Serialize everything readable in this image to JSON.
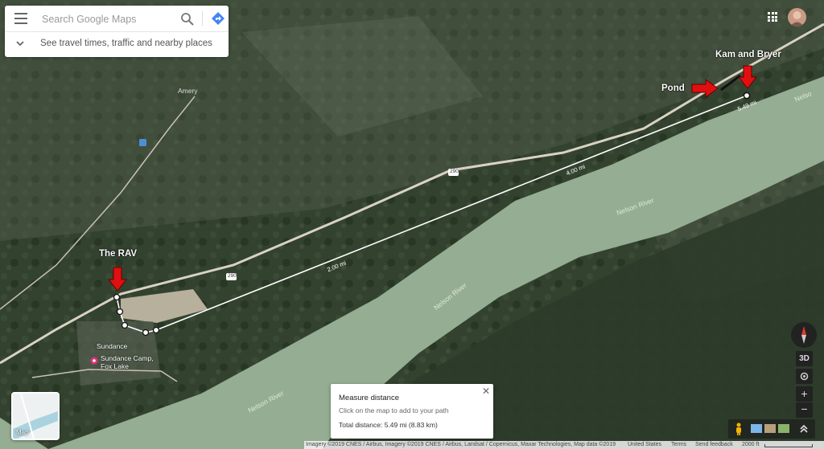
{
  "search": {
    "placeholder": "Search Google Maps"
  },
  "travel_prompt": "See travel times, traffic and nearby places",
  "icons": {
    "menu": "menu-icon",
    "search": "search-icon",
    "directions": "directions-icon",
    "expand": "chevron-down-icon",
    "apps": "apps-grid-icon",
    "close": "close-icon",
    "compass": "compass-icon",
    "location": "my-location-icon",
    "zoom_in": "plus-icon",
    "zoom_out": "minus-icon",
    "pegman": "pegman-icon",
    "expand_imagery": "chevron-up-double-icon"
  },
  "annotations": {
    "kam": "Kam and Bryer",
    "pond": "Pond",
    "rav": "The RAV"
  },
  "map_labels": {
    "amery": "Amery",
    "sundance": "Sundance",
    "sundance_camp": "Sundance Camp, Fox Lake",
    "highway_290_a": "290",
    "highway_290_b": "290",
    "nelson_1": "Nelson River",
    "nelson_2": "Nelson River",
    "nelson_3": "Nelson River",
    "nelson_4": "Nelso",
    "dist_2": "2.00 mi",
    "dist_4": "4.00 mi",
    "dist_end": "5.49 mi"
  },
  "measure": {
    "title": "Measure distance",
    "instruction": "Click on the map to add to your path",
    "total": "Total distance: 5.49 mi (8.83 km)"
  },
  "minimap_label": "Map",
  "controls": {
    "view3d": "3D"
  },
  "footer": {
    "attribution": "Imagery ©2019 CNES / Airbus, Imagery ©2019 CNES / Airbus, Landsat / Copernicus, Maxar Technologies, Map data ©2019",
    "country": "United States",
    "terms": "Terms",
    "feedback": "Send feedback",
    "scale": "2000 ft"
  },
  "colors": {
    "river": "#95ad92",
    "forest": "#2b3a29",
    "road": "#d9d2c2",
    "arrow": "#e01010",
    "route": "#ffffff",
    "accent": "#4285f4"
  }
}
